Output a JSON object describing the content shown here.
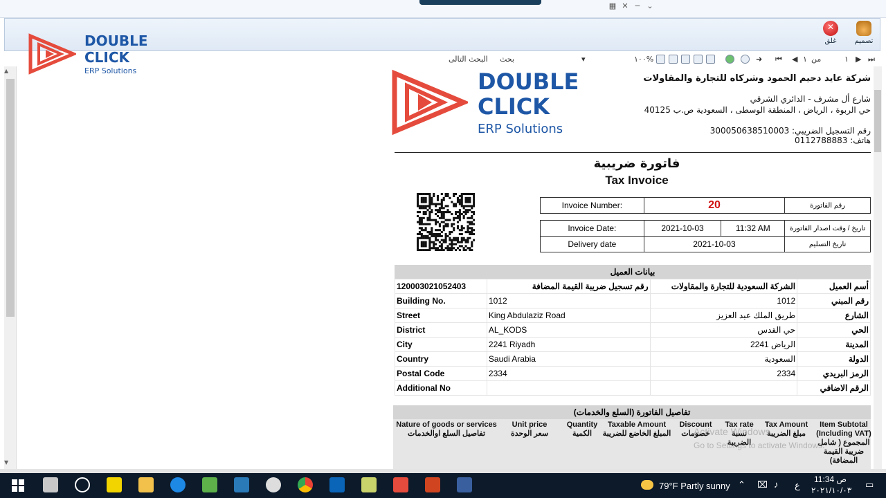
{
  "ribbon": {
    "close_label": "غلق",
    "design_label": "تصميم"
  },
  "top_logo": {
    "line1": "DOUBLE",
    "line2": "CLICK",
    "line3": "ERP Solutions"
  },
  "viewer_toolbar": {
    "next_search": "البحث التالى",
    "search": "بحث",
    "zoom": "١٠٠%",
    "of_label": "من",
    "page_total": "١",
    "page_current": "١"
  },
  "company": {
    "name": "شركة عايد دحيم الحمود وشركاه للتجارة والمقاولات",
    "street": "شارع أل مشرف - الدائري الشرقي",
    "address": "حي الربوة ، الرياض ، المنطقة الوسطى ، السعودية ص.ب 40125",
    "tax_reg": "رقم التسجيل الضريبي: 300050638510003",
    "phone": "هاتف: 0112788883"
  },
  "doc_logo": {
    "line1": "DOUBLE",
    "line2": "CLICK",
    "line3": "ERP Solutions"
  },
  "invoice": {
    "title_ar": "فاتورة ضريبية",
    "title_en": "Tax Invoice",
    "number_label": "Invoice Number:",
    "number_value": "20",
    "number_label_ar": "رقم الفاتورة",
    "date_label": "Invoice Date:",
    "date_value": "2021-10-03",
    "time_value": "11:32 AM",
    "date_label_ar": "تاريخ / وقت اصدار الفاتورة",
    "delivery_label": "Delivery date",
    "delivery_value": "2021-10-03",
    "delivery_label_ar": "تاريخ التسليم"
  },
  "customer": {
    "header": "بيانات العميل",
    "rows": [
      {
        "en_label": "120003021052403",
        "en_value": "رقم تسجيل ضريبة القيمة المضافة",
        "ar_value": "الشركة السعودية للتجارة والمقاولات",
        "ar_label": "أسم العميل"
      },
      {
        "en_label": "Building No.",
        "en_value": "1012",
        "ar_value": "1012",
        "ar_label": "رقم المبني"
      },
      {
        "en_label": "Street",
        "en_value": "King Abdulaziz Road",
        "ar_value": "طريق الملك عبد العزيز",
        "ar_label": "الشارع"
      },
      {
        "en_label": "District",
        "en_value": "AL_KODS",
        "ar_value": "حي القدس",
        "ar_label": "الحي"
      },
      {
        "en_label": "City",
        "en_value": "2241 Riyadh",
        "ar_value": "الرياض 2241",
        "ar_label": "المدينة"
      },
      {
        "en_label": "Country",
        "en_value": "Saudi Arabia",
        "ar_value": "السعودية",
        "ar_label": "الدولة"
      },
      {
        "en_label": "Postal Code",
        "en_value": "2334",
        "ar_value": "2334",
        "ar_label": "الرمز البريدي"
      },
      {
        "en_label": "Additional No",
        "en_value": "",
        "ar_value": "",
        "ar_label": "الرقم الاضافي"
      }
    ]
  },
  "items": {
    "header": "تفاصيل الفاتورة (السلع والخدمات)",
    "columns": [
      {
        "en": "Nature of goods or services",
        "ar": "تفاصيل السلع اوالخدمات"
      },
      {
        "en": "Unit price",
        "ar": "سعر الوحدة"
      },
      {
        "en": "Quantity",
        "ar": "الكمية"
      },
      {
        "en": "Taxable Amount",
        "ar": "المبلغ الخاضع للضريبة"
      },
      {
        "en": "Discount",
        "ar": "خصومات"
      },
      {
        "en": "Tax rate",
        "ar": "نسبة الضريبة"
      },
      {
        "en": "Tax Amount",
        "ar": "مبلغ الضريبة"
      },
      {
        "en": "Item Subtotal (Including VAT)",
        "ar": "المجموع ( شامل ضريبة القيمة المضافة)"
      }
    ]
  },
  "watermark": {
    "line1": "Activate Windows",
    "line2": "Go to Settings to activate Windows."
  },
  "tray": {
    "weather": "79°F  Partly sunny",
    "lang": "ع",
    "time": "11:34 ص",
    "date": "٢٠٢١/١٠/٠٣"
  }
}
